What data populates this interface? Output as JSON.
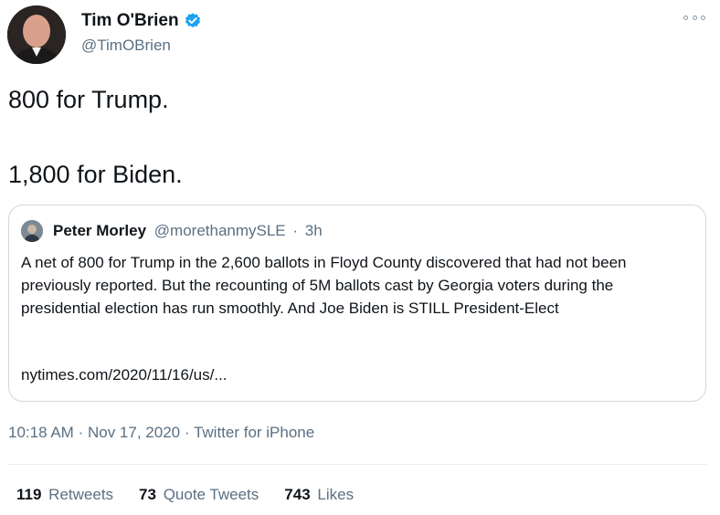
{
  "author": {
    "name": "Tim O'Brien",
    "handle": "@TimOBrien"
  },
  "tweet": {
    "line1": "800 for Trump.",
    "line2": "1,800 for Biden."
  },
  "quote": {
    "name": "Peter Morley",
    "handle": "@morethanmySLE",
    "separator": "·",
    "time": "3h",
    "body": "A net of 800 for Trump in the 2,600 ballots in Floyd County discovered that had not been previously reported. But the recounting of 5M ballots cast by Georgia voters during the presidential election has run smoothly. And Joe Biden is STILL President-Elect",
    "link": "nytimes.com/2020/11/16/us/..."
  },
  "meta": {
    "time": "10:18 AM",
    "separator": "·",
    "date": "Nov 17, 2020",
    "source": "Twitter for iPhone"
  },
  "stats": {
    "retweets_count": "119",
    "retweets_label": "Retweets",
    "quotes_count": "73",
    "quotes_label": "Quote Tweets",
    "likes_count": "743",
    "likes_label": "Likes"
  },
  "icons": {
    "verified": "verified-badge-icon",
    "more": "more-options-icon"
  },
  "colors": {
    "verified_blue": "#1da1f2",
    "secondary_text": "#5b7083",
    "border": "#cfd9de"
  }
}
